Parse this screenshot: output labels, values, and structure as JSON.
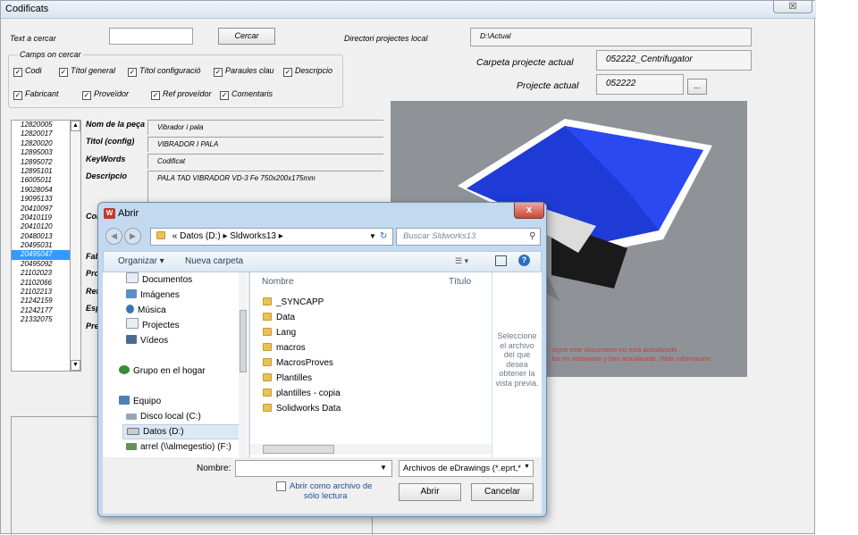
{
  "window": {
    "title": "Codificats",
    "close": "☒"
  },
  "search": {
    "text_label": "Text a cercar",
    "text_value": "",
    "button": "Cercar",
    "dir_label": "Directori projectes local",
    "dir_value": "D:\\Actual"
  },
  "fields_group": {
    "title": "Camps on cercar",
    "checks": [
      {
        "label": "Codi",
        "checked": true
      },
      {
        "label": "Títol general",
        "checked": true
      },
      {
        "label": "Títol configuració",
        "checked": true
      },
      {
        "label": "Paraules clau",
        "checked": true
      },
      {
        "label": "Descripcio",
        "checked": true
      },
      {
        "label": "Fabricant",
        "checked": true
      },
      {
        "label": "Proveïdor",
        "checked": true
      },
      {
        "label": "Ref proveïdor",
        "checked": true
      },
      {
        "label": "Comentaris",
        "checked": true
      }
    ]
  },
  "project": {
    "carpeta_label": "Carpeta projecte actual",
    "carpeta_value": "052222_Centrifugator",
    "projecte_label": "Projecte actual",
    "projecte_value": "052222",
    "browse": "..."
  },
  "codes": [
    "12820005",
    "12820017",
    "12820020",
    "12895003",
    "12895072",
    "12895101",
    "16005011",
    "19028054",
    "19095133",
    "20410097",
    "20410119",
    "20410120",
    "20480013",
    "20495031",
    "20495047",
    "20495092",
    "21102023",
    "21102066",
    "21102213",
    "21242159",
    "21242177",
    "21332075"
  ],
  "selected_code": "20495047",
  "details": {
    "nom_label": "Nom de la peça",
    "nom_value": "Vibrador i pala",
    "titol_label": "Titol (config)",
    "titol_value": "VIBRADOR I PALA",
    "keywords_label": "KeyWords",
    "keywords_value": "Codificat",
    "desc_label": "Descripcio",
    "desc_value": "PALA TAD VIBRADOR VD-3 Fe 750x200x175mm",
    "partial_labels": [
      "Cor",
      "Fab",
      "Pro",
      "Ref",
      "Esp",
      "Pre"
    ]
  },
  "preview_warning": [
    "... sigue este documento no está actualizado ...",
    "... los en ordenarse y han actualizado. (Más información"
  ],
  "dialog": {
    "title": "Abrir",
    "close": "x",
    "path": [
      "«",
      "Datos (D:)",
      "Sldworks13"
    ],
    "search_placeholder": "Buscar Sldworks13",
    "organize": "Organizar ▾",
    "new_folder": "Nueva carpeta",
    "nav_items": [
      {
        "label": "Documentos",
        "icon": "documents-icon"
      },
      {
        "label": "Imágenes",
        "icon": "images-icon"
      },
      {
        "label": "Música",
        "icon": "music-icon"
      },
      {
        "label": "Projectes",
        "icon": "projects-icon"
      },
      {
        "label": "Vídeos",
        "icon": "videos-icon"
      },
      {
        "label": "Grupo en el hogar",
        "icon": "homegroup-icon"
      },
      {
        "label": "Equipo",
        "icon": "computer-icon"
      },
      {
        "label": "Disco local (C:)",
        "icon": "drive-icon"
      },
      {
        "label": "Datos (D:)",
        "icon": "drive-icon"
      },
      {
        "label": "arrel (\\\\almegestio) (F:)",
        "icon": "network-drive-icon"
      }
    ],
    "col_name": "Nombre",
    "col_title": "Título",
    "files": [
      "_SYNCAPP",
      "Data",
      "Lang",
      "macros",
      "MacrosProves",
      "Plantilles",
      "plantilles - copia",
      "Solidworks Data"
    ],
    "preview_text": [
      "Seleccione",
      "el archivo",
      "del que",
      "desea",
      "obtener la",
      "vista previa."
    ],
    "filename_label": "Nombre:",
    "filename_value": "",
    "filetype": "Archivos de eDrawings (*.eprt,*",
    "readonly_label": [
      "Abrir como archivo de",
      "sólo lectura"
    ],
    "open_button": "Abrir",
    "cancel_button": "Cancelar"
  },
  "colors": {
    "accent_selection": "#3399ff",
    "model_blue": "#1f3bd6",
    "viewport_bg": "#8f9398"
  }
}
